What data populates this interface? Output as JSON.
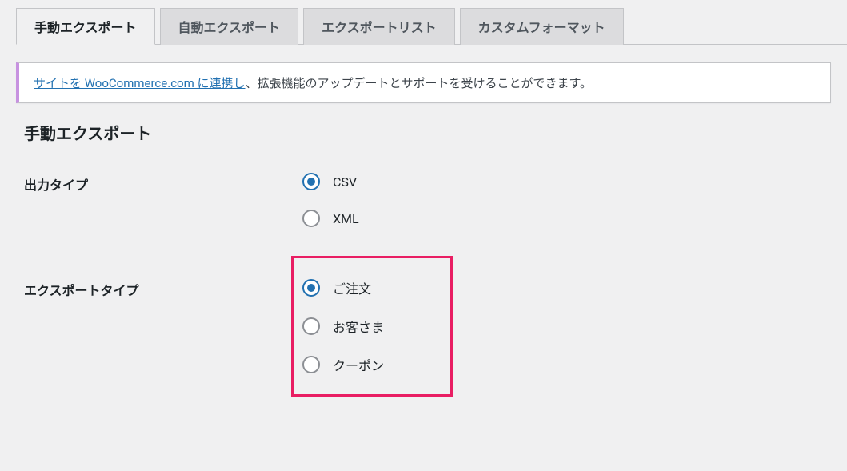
{
  "tabs": [
    {
      "label": "手動エクスポート",
      "active": true
    },
    {
      "label": "自動エクスポート",
      "active": false
    },
    {
      "label": "エクスポートリスト",
      "active": false
    },
    {
      "label": "カスタムフォーマット",
      "active": false
    }
  ],
  "notice": {
    "link_text": "サイトを WooCommerce.com に連携し",
    "suffix": "、拡張機能のアップデートとサポートを受けることができます。"
  },
  "page_title": "手動エクスポート",
  "sections": {
    "output_type": {
      "label": "出力タイプ",
      "options": [
        {
          "label": "CSV",
          "checked": true
        },
        {
          "label": "XML",
          "checked": false
        }
      ]
    },
    "export_type": {
      "label": "エクスポートタイプ",
      "options": [
        {
          "label": "ご注文",
          "checked": true
        },
        {
          "label": "お客さま",
          "checked": false
        },
        {
          "label": "クーポン",
          "checked": false
        }
      ]
    }
  }
}
